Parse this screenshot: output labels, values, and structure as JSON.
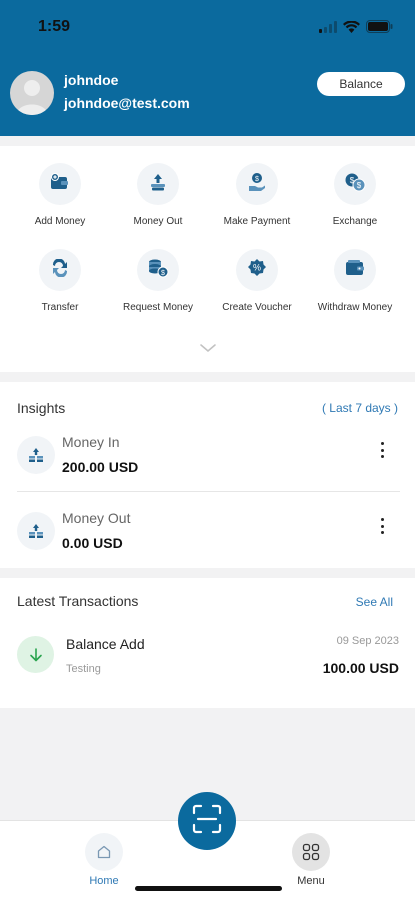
{
  "status": {
    "time": "1:59"
  },
  "user": {
    "username": "johndoe",
    "email": "johndoe@test.com"
  },
  "header": {
    "balance_label": "Balance"
  },
  "actions": [
    {
      "label": "Add Money",
      "icon": "wallet-plus-icon"
    },
    {
      "label": "Money Out",
      "icon": "money-out-icon"
    },
    {
      "label": "Make Payment",
      "icon": "payment-hand-icon"
    },
    {
      "label": "Exchange",
      "icon": "exchange-coins-icon"
    },
    {
      "label": "Transfer",
      "icon": "transfer-arrows-icon"
    },
    {
      "label": "Request Money",
      "icon": "request-coins-icon"
    },
    {
      "label": "Create Voucher",
      "icon": "voucher-percent-icon"
    },
    {
      "label": "Withdraw Money",
      "icon": "withdraw-wallet-icon"
    }
  ],
  "insights": {
    "title": "Insights",
    "period": "( Last 7 days )",
    "items": [
      {
        "label": "Money In",
        "value": "200.00 USD"
      },
      {
        "label": "Money Out",
        "value": "0.00 USD"
      }
    ]
  },
  "transactions": {
    "title": "Latest Transactions",
    "see_all": "See All",
    "items": [
      {
        "title": "Balance Add",
        "subtitle": "Testing",
        "date": "09 Sep 2023",
        "amount": "100.00 USD"
      }
    ]
  },
  "nav": {
    "home": "Home",
    "menu": "Menu"
  },
  "colors": {
    "brand": "#0b6a9e",
    "accent_link": "#2f79b4",
    "success_bg": "#dff3e4",
    "success": "#2aa44f"
  }
}
